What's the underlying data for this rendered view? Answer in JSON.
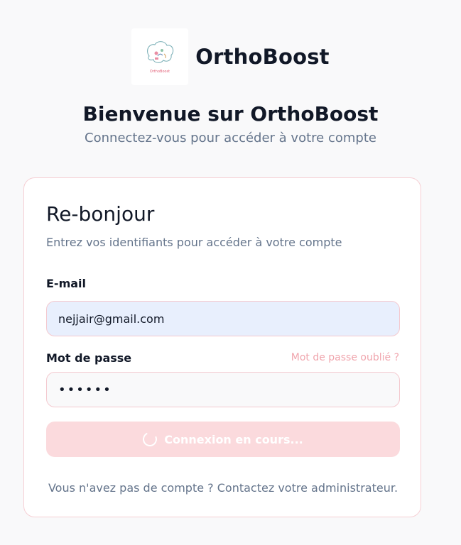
{
  "brand": {
    "name": "OrthoBoost",
    "logo_text": "OrthoBoost"
  },
  "welcome": {
    "title": "Bienvenue sur OrthoBoost",
    "subtitle": "Connectez-vous pour accéder à votre compte"
  },
  "login_card": {
    "title": "Re-bonjour",
    "subtitle": "Entrez vos identifiants pour accéder à votre compte",
    "email_label": "E-mail",
    "email_value": "nejjair@gmail.com",
    "password_label": "Mot de passe",
    "password_value": "••••••",
    "forgot_link": "Mot de passe oublié ?",
    "submit_label": "Connexion en cours...",
    "footer": "Vous n'avez pas de compte ? Contactez votre administrateur."
  },
  "colors": {
    "accent_pink": "#f0a5ad",
    "card_border": "#f6cfd4",
    "submit_bg": "#fbdadd",
    "email_bg": "#e8effd",
    "muted_text": "#64748b",
    "heading_text": "#111827"
  }
}
